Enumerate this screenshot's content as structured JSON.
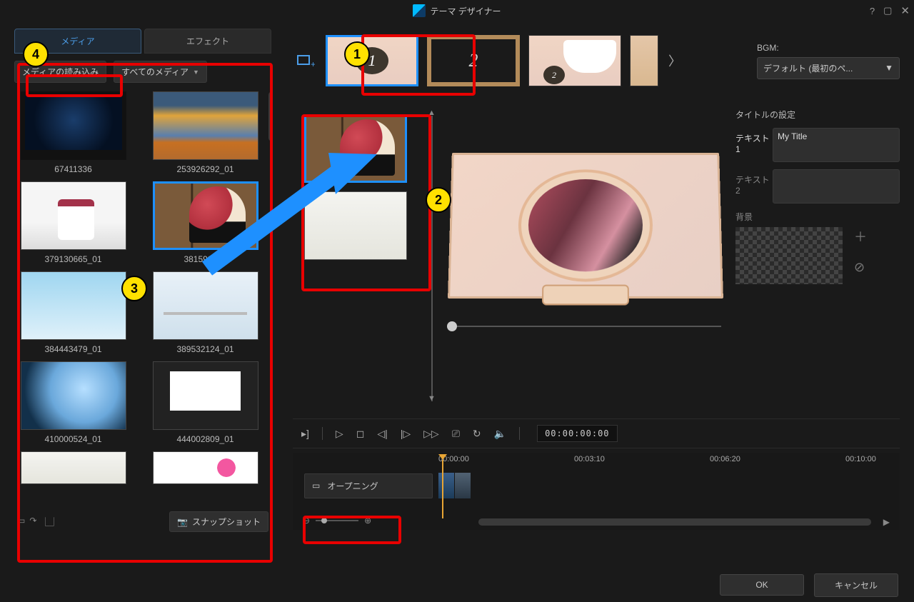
{
  "window": {
    "title": "テーマ デザイナー"
  },
  "tabs": {
    "media": "メディア",
    "effects": "エフェクト"
  },
  "toolbar": {
    "import": "メディアの読み込み",
    "all_media": "すべてのメディア"
  },
  "media_items": [
    {
      "label": "67411336"
    },
    {
      "label": "253926292_01"
    },
    {
      "label": "379130665_01"
    },
    {
      "label": "381599107"
    },
    {
      "label": "384443479_01"
    },
    {
      "label": "389532124_01"
    },
    {
      "label": "410000524_01"
    },
    {
      "label": "444002809_01"
    }
  ],
  "snapshot_label": "スナップショット",
  "bgm": {
    "label": "BGM:",
    "selected": "デフォルト (最初のペ..."
  },
  "settings": {
    "title_section": "タイトルの設定",
    "text1_label": "テキスト 1",
    "text1_value": "My Title",
    "text2_label": "テキスト 2",
    "bg_label": "背景"
  },
  "timecode": "00:00:00:00",
  "timeline": {
    "track_label": "オープニング",
    "marks": [
      "00:00:00",
      "00:03:10",
      "00:06:20",
      "00:10:00"
    ]
  },
  "footer": {
    "ok": "OK",
    "cancel": "キャンセル"
  },
  "callouts": {
    "b1": "1",
    "b2": "2",
    "b3": "3",
    "b4": "4"
  }
}
